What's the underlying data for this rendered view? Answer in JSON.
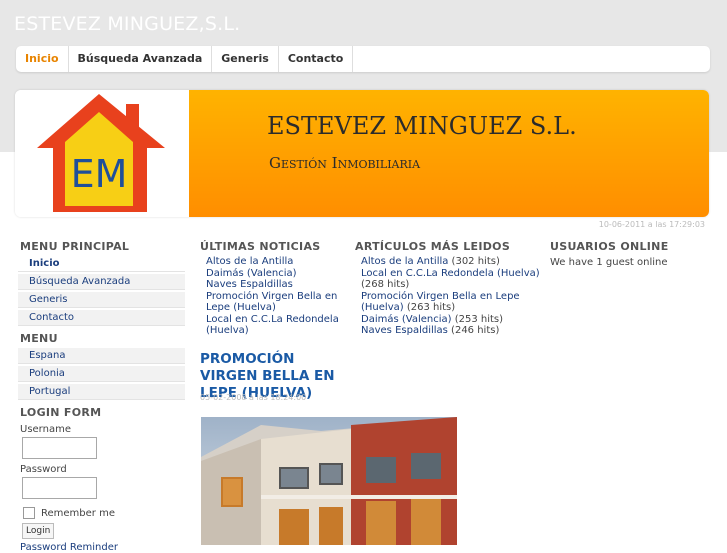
{
  "site": {
    "title": "ESTEVEZ MINGUEZ,S.L."
  },
  "nav": {
    "items": [
      {
        "label": "Inicio"
      },
      {
        "label": "Búsqueda Avanzada"
      },
      {
        "label": "Generis"
      },
      {
        "label": "Contacto"
      }
    ]
  },
  "banner": {
    "logo_text": "EM",
    "title": "ESTEVEZ MINGUEZ S.L.",
    "subtitle": "Gestión Inmobiliaria"
  },
  "date": "10-06-2011 a las 17:29:03",
  "left": {
    "menu_principal": {
      "title": "MENU PRINCIPAL",
      "items": [
        {
          "label": "Inicio"
        },
        {
          "label": "Búsqueda Avanzada"
        },
        {
          "label": "Generis"
        },
        {
          "label": "Contacto"
        }
      ]
    },
    "menu": {
      "title": "MENU",
      "items": [
        {
          "label": "Espana"
        },
        {
          "label": "Polonia"
        },
        {
          "label": "Portugal"
        }
      ]
    },
    "login": {
      "title": "LOGIN FORM",
      "username_label": "Username",
      "password_label": "Password",
      "remember_label": "Remember me",
      "button_label": "Login",
      "reminder_link": "Password Reminder"
    }
  },
  "news": {
    "title": "ÚLTIMAS NOTICIAS",
    "items": [
      {
        "label": "Altos de la Antilla"
      },
      {
        "label": "Daimás (Valencia)"
      },
      {
        "label": "Naves Espaldillas"
      },
      {
        "label": "Promoción Virgen Bella en Lepe (Huelva)"
      },
      {
        "label": "Local en C.C.La Redondela (Huelva)"
      }
    ]
  },
  "most_read": {
    "title": "ARTÍCULOS MÁS LEIDOS",
    "items": [
      {
        "label": "Altos de la Antilla",
        "hits": " (302 hits)"
      },
      {
        "label": "Local en C.C.La Redondela (Huelva)",
        "hits": " (268 hits)"
      },
      {
        "label": "Promoción Virgen Bella en Lepe (Huelva)",
        "hits": " (263 hits)"
      },
      {
        "label": "Daimás (Valencia)",
        "hits": " (253 hits)"
      },
      {
        "label": "Naves Espaldillas",
        "hits": " (246 hits)"
      }
    ]
  },
  "online": {
    "title": "USUARIOS ONLINE",
    "text": "We have 1 guest online"
  },
  "article": {
    "title": "PROMOCIÓN VIRGEN BELLA EN LEPE (HUELVA)",
    "date": "05-02-2008 a las 18:24:00"
  },
  "colors": {
    "accent": "#e88400",
    "link": "#1a3d7d",
    "article_title": "#1a5aa5",
    "banner_orange": "#ffa200"
  }
}
